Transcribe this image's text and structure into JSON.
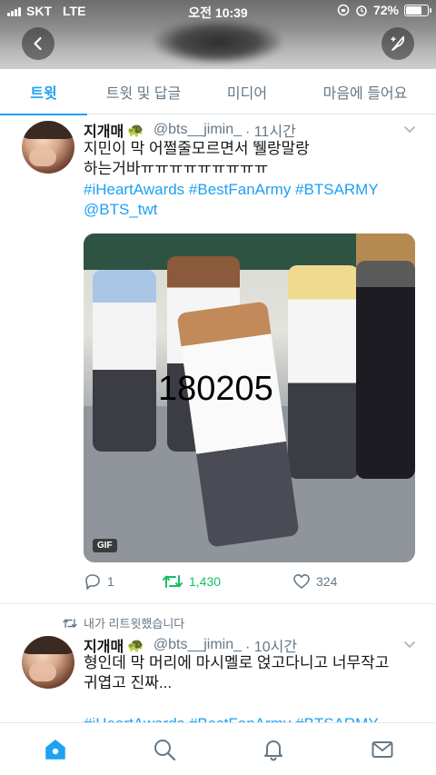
{
  "status_bar": {
    "carrier": "SKT",
    "network": "LTE",
    "time": "오전 10:39",
    "battery": "72%",
    "battery_level": 0.72
  },
  "header": {
    "back_icon": "back-arrow-icon",
    "compose_icon": "compose-feather-icon"
  },
  "tabs": [
    {
      "label": "트윗",
      "active": true
    },
    {
      "label": "트윗 및 답글",
      "active": false
    },
    {
      "label": "미디어",
      "active": false
    },
    {
      "label": "마음에 들어요",
      "active": false
    }
  ],
  "tweets": [
    {
      "name": "지개매",
      "emoji": "🐢",
      "handle": "@bts__jimin_",
      "time": "· 11시간",
      "text": "지민이 막 어쩔줄모르면서 뛜랑말랑\n하는거바ㅠㅠㅠㅠㅠㅠㅠㅠㅠ",
      "hashtags": "#iHeartAwards #BestFanArmy #BTSARMY @BTS_twt",
      "media": {
        "badge": "GIF",
        "overlay": "180205"
      },
      "replies": "1",
      "retweets": "1,430",
      "likes": "324"
    },
    {
      "retweet_label": "내가 리트윗했습니다",
      "name": "지개매",
      "emoji": "🐢",
      "handle": "@bts__jimin_",
      "time": "· 10시간",
      "text": "형인데 막 머리에 마시멜로 얹고다니고 너무작고\n귀엽고 진짜...",
      "hashtags": "#iHeartAwards #BestFanArmy #BTSARMY"
    }
  ],
  "bottom_nav": [
    {
      "icon": "home-icon",
      "active": true
    },
    {
      "icon": "search-icon",
      "active": false
    },
    {
      "icon": "notifications-bell-icon",
      "active": false
    },
    {
      "icon": "messages-mail-icon",
      "active": false
    }
  ],
  "colors": {
    "accent": "#1da1f2",
    "retweet_green": "#17bf63",
    "muted": "#657786",
    "text": "#14171a"
  }
}
